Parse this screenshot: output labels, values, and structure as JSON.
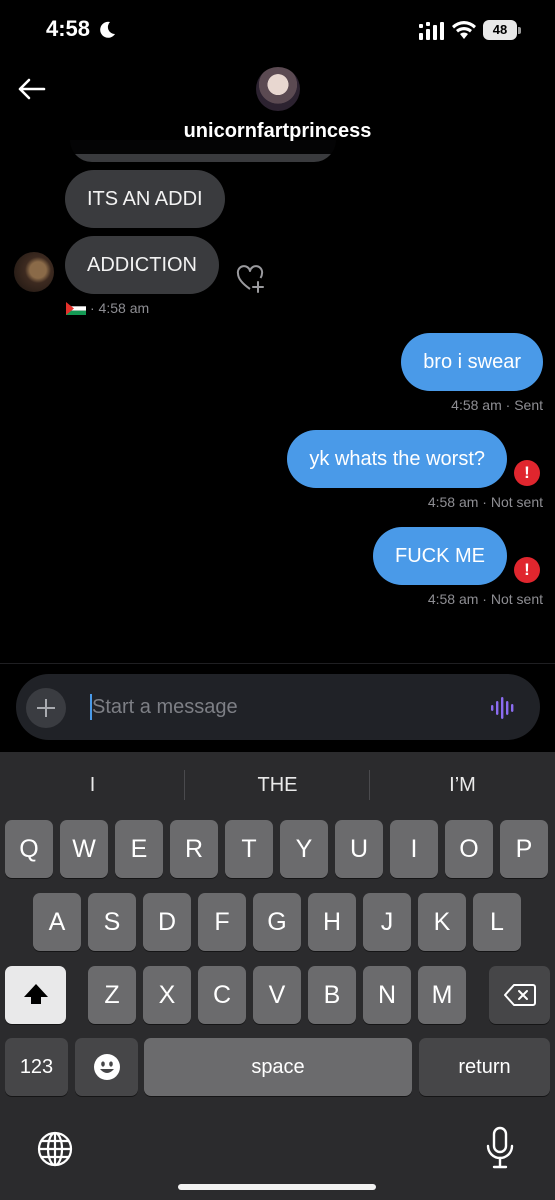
{
  "status_bar": {
    "time": "4:58",
    "battery": "48"
  },
  "header": {
    "contact_name": "unicornfartprincess"
  },
  "messages": {
    "incoming": [
      {
        "text": "ITS AN ADDI"
      },
      {
        "text": "ADDICTION"
      }
    ],
    "incoming_meta": "· 4:58 am",
    "outgoing": [
      {
        "text": "bro i swear",
        "meta": "4:58 am · Sent",
        "error": false
      },
      {
        "text": "yk whats the worst?",
        "meta": "4:58 am · Not sent",
        "error": true
      },
      {
        "text": "FUCK ME",
        "meta": "4:58 am · Not sent",
        "error": true
      }
    ],
    "error_mark": "!"
  },
  "composer": {
    "placeholder": "Start a message"
  },
  "keyboard": {
    "suggestions": [
      "I",
      "THE",
      "I’M"
    ],
    "row1": [
      "Q",
      "W",
      "E",
      "R",
      "T",
      "Y",
      "U",
      "I",
      "O",
      "P"
    ],
    "row2": [
      "A",
      "S",
      "D",
      "F",
      "G",
      "H",
      "J",
      "K",
      "L"
    ],
    "row3": [
      "Z",
      "X",
      "C",
      "V",
      "B",
      "N",
      "M"
    ],
    "numbers_label": "123",
    "space_label": "space",
    "return_label": "return"
  },
  "colors": {
    "outgoing_bubble": "#4a9ae8",
    "incoming_bubble": "#3a3b3e",
    "error": "#e0262e",
    "voice_accent": "#8b6cf0"
  },
  "icons": [
    "back-arrow-icon",
    "heart-add-icon",
    "plus-icon",
    "voice-wave-icon",
    "shift-icon",
    "delete-icon",
    "emoji-icon",
    "globe-icon",
    "mic-icon",
    "moon-icon",
    "signal-icon",
    "wifi-icon"
  ]
}
